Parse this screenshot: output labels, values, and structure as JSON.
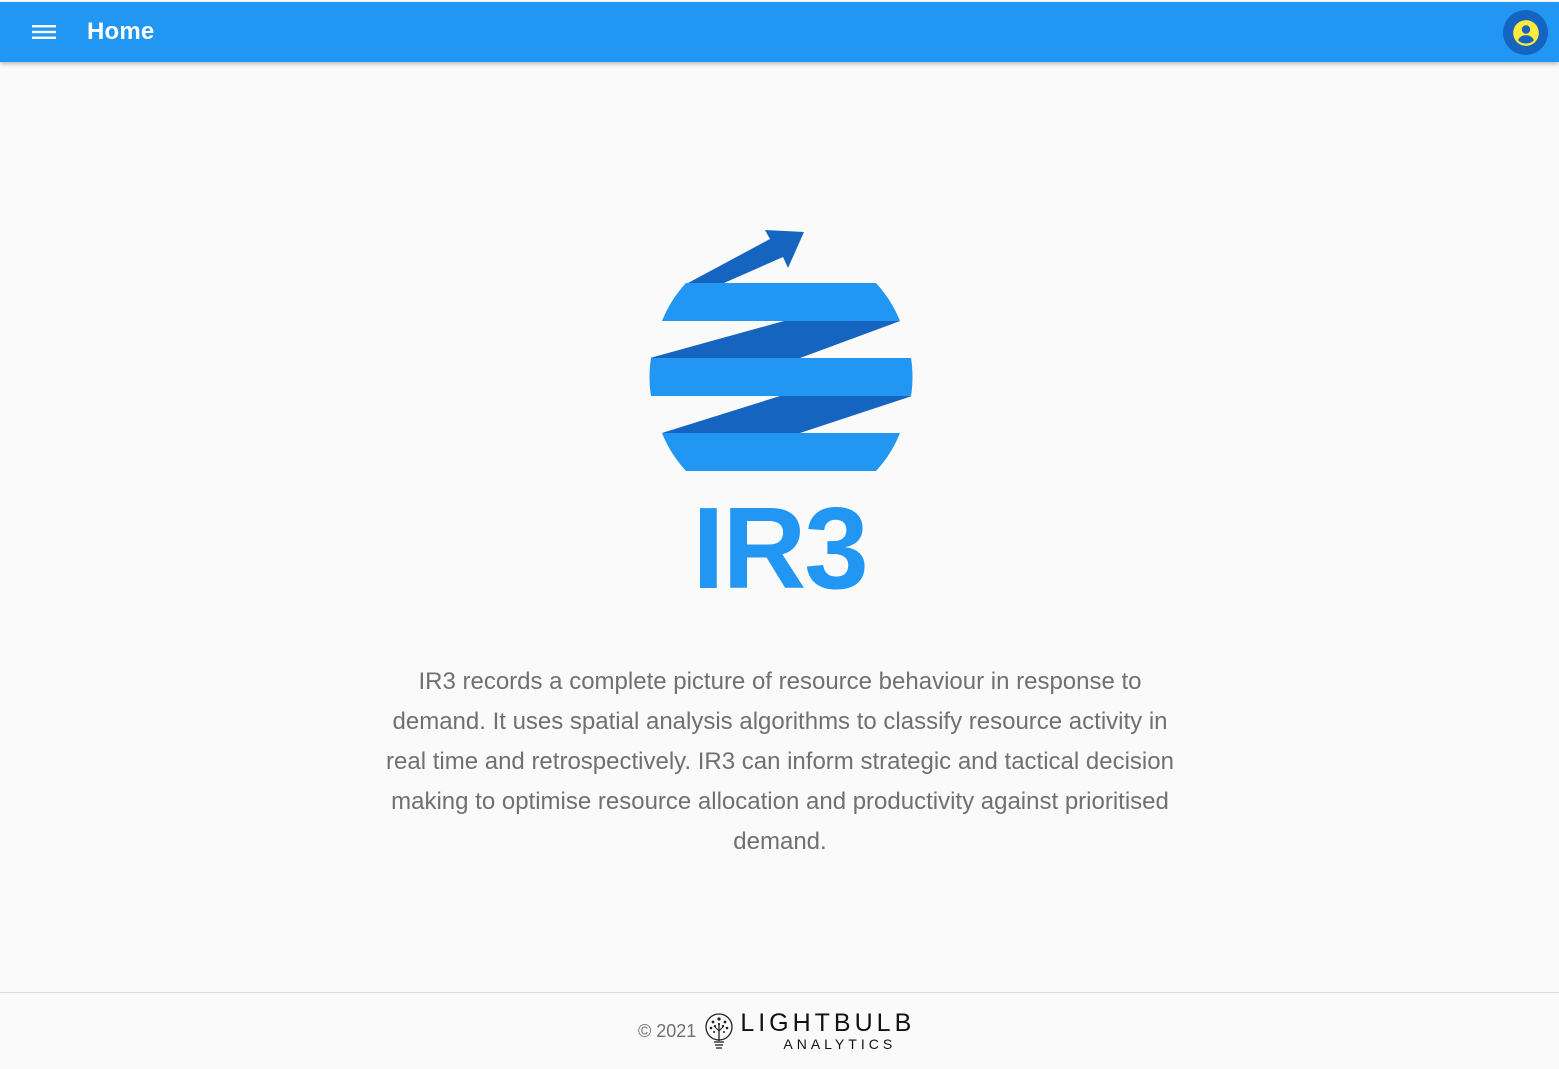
{
  "header": {
    "title": "Home",
    "menu_icon": "menu-icon",
    "account_icon": "account-circle-icon"
  },
  "hero": {
    "brand_name": "IR3",
    "description": "IR3 records a complete picture of resource behaviour in response to demand. It uses spatial analysis algorithms to classify resource activity in real time and retrospectively. IR3 can inform strategic and tactical decision making to optimise resource allocation and productivity against prioritised demand."
  },
  "footer": {
    "copyright": "© 2021",
    "company_main": "LIGHTBULB",
    "company_sub": "ANALYTICS"
  },
  "colors": {
    "primary": "#2196f3",
    "primary_dark": "#1565c0",
    "account_icon": "#ffeb3b",
    "text_muted": "#707070",
    "background": "#fafafa"
  }
}
